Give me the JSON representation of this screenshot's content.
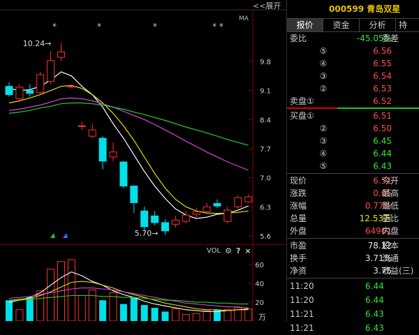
{
  "toolbar": {
    "expand_label": "<<展开",
    "ma_label": "MA",
    "vol_label": "VOL",
    "gear_icon": "⚙",
    "help_icon": "?",
    "close_icon": "×"
  },
  "stock": {
    "code": "000599",
    "name": "青岛双星",
    "display": "000599 青岛双星"
  },
  "tabs": [
    {
      "label": "报价",
      "active": true
    },
    {
      "label": "资金",
      "active": false
    },
    {
      "label": "分析",
      "active": false
    },
    {
      "label": "持",
      "active": false
    }
  ],
  "weibi": {
    "label": "委比",
    "value": "-45.05%",
    "right_label": "委差"
  },
  "asks": [
    {
      "level": "⑤",
      "price": "6.56"
    },
    {
      "level": "④",
      "price": "6.55"
    },
    {
      "level": "③",
      "price": "6.54"
    },
    {
      "level": "②",
      "price": "6.53"
    },
    {
      "level": "卖盘①",
      "price": "6.52"
    }
  ],
  "bids": [
    {
      "level": "买盘①",
      "price": "6.51",
      "color": "red"
    },
    {
      "level": "②",
      "price": "6.50",
      "color": "red"
    },
    {
      "level": "③",
      "price": "6.45",
      "color": "green"
    },
    {
      "level": "④",
      "price": "6.44",
      "color": "green"
    },
    {
      "level": "⑤",
      "price": "6.43",
      "color": "green"
    }
  ],
  "quote": [
    {
      "label": "现价",
      "value": "6.51",
      "color": "red",
      "right": "今开"
    },
    {
      "label": "涨跌",
      "value": "0.05",
      "color": "red",
      "right": "最高"
    },
    {
      "label": "涨幅",
      "value": "0.77%",
      "color": "red",
      "right": "最低"
    },
    {
      "label": "总量",
      "value": "12.53万",
      "color": "yellow",
      "right": "量比"
    },
    {
      "label": "外盘",
      "value": "64961",
      "color": "red",
      "right": "内盘"
    }
  ],
  "fundamentals": [
    {
      "label": "市盈",
      "value": "78.12",
      "right": "股本"
    },
    {
      "label": "换手",
      "value": "3.71%",
      "right": "流通"
    },
    {
      "label": "净资",
      "value": "3.75",
      "right": "收益(三)"
    }
  ],
  "ticks": [
    {
      "time": "11:20",
      "price": "6.44"
    },
    {
      "time": "11:20",
      "price": "6.44"
    },
    {
      "time": "11:21",
      "price": "6.43"
    },
    {
      "time": "11:21",
      "price": "6.43"
    }
  ],
  "chart_data": {
    "type": "candlestick",
    "price_axis": {
      "ticks": [
        "9.8",
        "9.1",
        "8.4",
        "7.7",
        "7.0",
        "6.3",
        "5.6"
      ],
      "min": 5.6,
      "max": 9.8
    },
    "volume_axis": {
      "ticks": [
        "60",
        "40",
        "20"
      ],
      "unit": "万"
    },
    "annotations": [
      {
        "text": "10.24",
        "price": 10.24
      },
      {
        "text": "5.70",
        "price": 5.7
      }
    ],
    "markers": [
      "*",
      "*",
      "*",
      "* *"
    ],
    "candles": [
      {
        "o": 9.2,
        "c": 9.0,
        "h": 9.3,
        "l": 8.95
      },
      {
        "o": 8.9,
        "c": 9.18,
        "h": 9.25,
        "l": 8.85
      },
      {
        "o": 9.1,
        "c": 9.03,
        "h": 9.25,
        "l": 8.95
      },
      {
        "o": 9.05,
        "c": 9.48,
        "h": 9.55,
        "l": 9.0
      },
      {
        "o": 9.32,
        "c": 9.82,
        "h": 10.05,
        "l": 9.25
      },
      {
        "o": 9.9,
        "c": 10.03,
        "h": 10.24,
        "l": 9.8
      },
      {
        "o": 9.2,
        "c": 9.2,
        "h": 9.25,
        "l": 9.15
      },
      {
        "o": 8.25,
        "c": 8.25,
        "h": 8.35,
        "l": 8.15
      },
      {
        "o": 8.0,
        "c": 8.15,
        "h": 8.3,
        "l": 7.95
      },
      {
        "o": 7.95,
        "c": 7.4,
        "h": 8.0,
        "l": 7.2
      },
      {
        "o": 7.5,
        "c": 7.62,
        "h": 7.85,
        "l": 7.4
      },
      {
        "o": 7.38,
        "c": 6.8,
        "h": 7.4,
        "l": 6.75
      },
      {
        "o": 6.8,
        "c": 6.4,
        "h": 6.82,
        "l": 6.15
      },
      {
        "o": 6.2,
        "c": 5.82,
        "h": 6.3,
        "l": 5.72
      },
      {
        "o": 6.08,
        "c": 5.92,
        "h": 6.2,
        "l": 5.85
      },
      {
        "o": 5.92,
        "c": 5.72,
        "h": 6.0,
        "l": 5.62
      },
      {
        "o": 5.88,
        "c": 5.98,
        "h": 6.08,
        "l": 5.8
      },
      {
        "o": 5.95,
        "c": 6.1,
        "h": 6.2,
        "l": 5.9
      },
      {
        "o": 6.12,
        "c": 6.18,
        "h": 6.28,
        "l": 6.05
      },
      {
        "o": 6.18,
        "c": 6.3,
        "h": 6.4,
        "l": 6.12
      },
      {
        "o": 6.38,
        "c": 6.32,
        "h": 6.48,
        "l": 6.28
      },
      {
        "o": 5.95,
        "c": 6.22,
        "h": 6.3,
        "l": 5.9
      },
      {
        "o": 6.3,
        "c": 6.52,
        "h": 6.58,
        "l": 6.25
      },
      {
        "o": 6.42,
        "c": 6.54,
        "h": 6.6,
        "l": 6.4
      }
    ],
    "volumes": [
      22,
      12,
      25,
      32,
      55,
      63,
      65,
      27,
      33,
      22,
      30,
      18,
      25,
      17,
      14,
      10,
      13,
      7,
      8,
      11,
      12,
      12,
      14,
      13
    ],
    "ma": [
      {
        "color": "#ffffff",
        "values": [
          9.15,
          9.1,
          9.12,
          9.2,
          9.35,
          9.55,
          9.45,
          9.2,
          9.0,
          8.7,
          8.3,
          7.95,
          7.55,
          7.15,
          6.8,
          6.5,
          6.25,
          6.1,
          6.02,
          6.05,
          6.12,
          6.15,
          6.22,
          6.32
        ]
      },
      {
        "color": "#e8e000",
        "values": [
          8.8,
          8.85,
          8.92,
          9.0,
          9.1,
          9.2,
          9.22,
          9.15,
          9.0,
          8.8,
          8.55,
          8.25,
          7.9,
          7.5,
          7.1,
          6.75,
          6.48,
          6.3,
          6.2,
          6.15,
          6.14,
          6.15,
          6.17,
          6.2
        ]
      },
      {
        "color": "#e040e0",
        "values": [
          8.62,
          8.65,
          8.7,
          8.75,
          8.82,
          8.9,
          8.92,
          8.9,
          8.85,
          8.78,
          8.7,
          8.6,
          8.5,
          8.4,
          8.28,
          8.15,
          8.02,
          7.88,
          7.75,
          7.62,
          7.5,
          7.38,
          7.28,
          7.18
        ]
      },
      {
        "color": "#20d020",
        "values": [
          8.55,
          8.58,
          8.62,
          8.68,
          8.72,
          8.78,
          8.8,
          8.8,
          8.78,
          8.75,
          8.7,
          8.65,
          8.58,
          8.52,
          8.45,
          8.38,
          8.3,
          8.22,
          8.15,
          8.08,
          8.0,
          7.92,
          7.85,
          7.78
        ]
      }
    ],
    "vol_ma": [
      {
        "color": "#ffffff",
        "values": [
          20,
          22,
          25,
          30,
          38,
          46,
          52,
          48,
          42,
          38,
          32,
          28,
          25,
          21,
          18,
          16,
          14,
          12,
          11,
          10,
          10,
          11,
          12,
          13
        ]
      },
      {
        "color": "#e8e000",
        "values": [
          22,
          23,
          24,
          27,
          31,
          36,
          41,
          42,
          41,
          38,
          35,
          31,
          28,
          25,
          22,
          19,
          17,
          15,
          13,
          12,
          12,
          11,
          12,
          12
        ]
      },
      {
        "color": "#e040e0",
        "values": [
          24,
          25,
          26,
          28,
          30,
          32,
          34,
          35,
          35,
          34,
          33,
          31,
          29,
          27,
          25,
          23,
          21,
          19,
          18,
          17,
          16,
          15,
          15,
          14
        ]
      },
      {
        "color": "#20d020",
        "values": [
          22,
          22,
          23,
          24,
          25,
          26,
          27,
          27,
          27,
          26,
          26,
          25,
          25,
          24,
          23,
          22,
          22,
          21,
          20,
          20,
          19,
          19,
          18,
          18
        ]
      }
    ]
  }
}
